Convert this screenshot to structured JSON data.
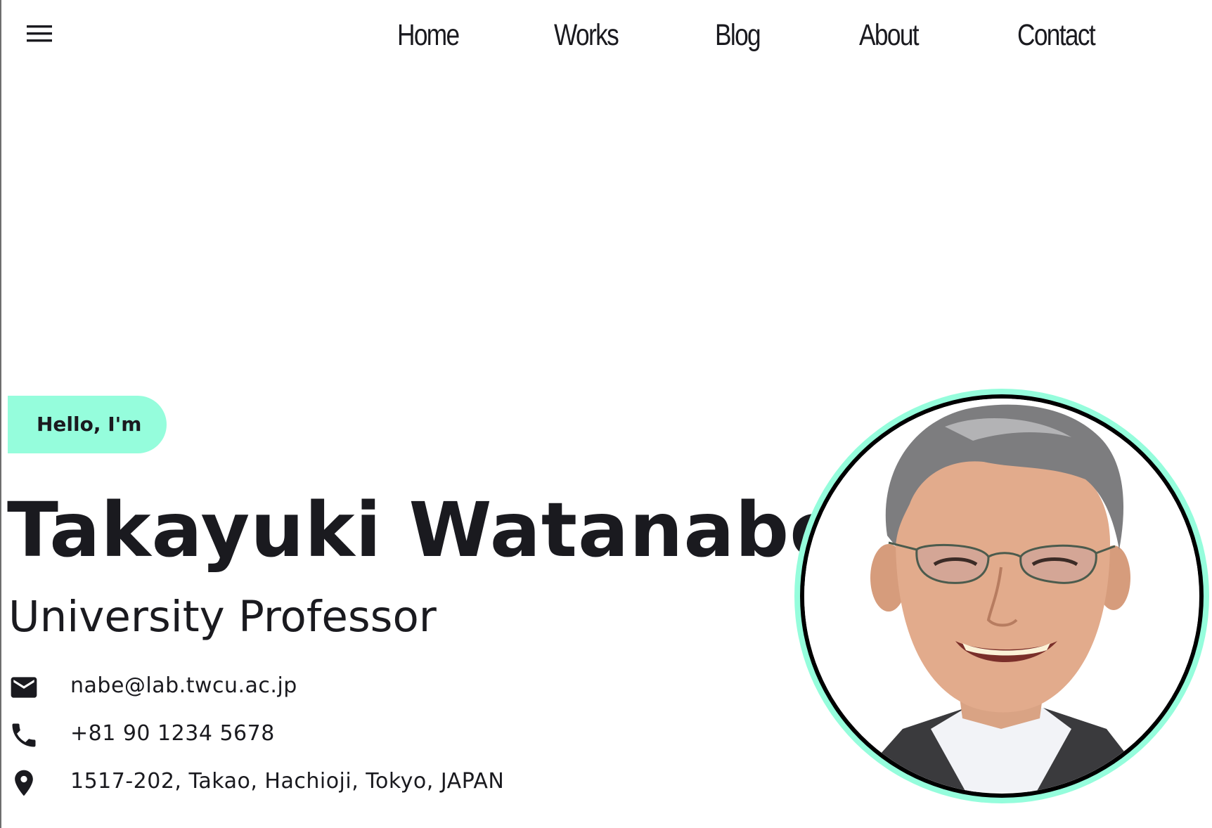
{
  "header": {
    "menu_icon": "hamburger-menu-icon",
    "nav": [
      {
        "label": "Home"
      },
      {
        "label": "Works"
      },
      {
        "label": "Blog"
      },
      {
        "label": "About"
      },
      {
        "label": "Contact"
      }
    ]
  },
  "hero": {
    "greeting": "Hello, I'm",
    "name": "Takayuki Watanabe",
    "title": "University Professor",
    "accent_color": "#95fddc"
  },
  "contact": {
    "email": {
      "icon": "mail-icon",
      "value": "nabe@lab.twcu.ac.jp"
    },
    "phone": {
      "icon": "phone-icon",
      "value": "+81 90 1234 5678"
    },
    "address": {
      "icon": "location-pin-icon",
      "value": "1517-202, Takao, Hachioji, Tokyo, JAPAN"
    }
  },
  "portrait": {
    "icon": "profile-photo"
  }
}
